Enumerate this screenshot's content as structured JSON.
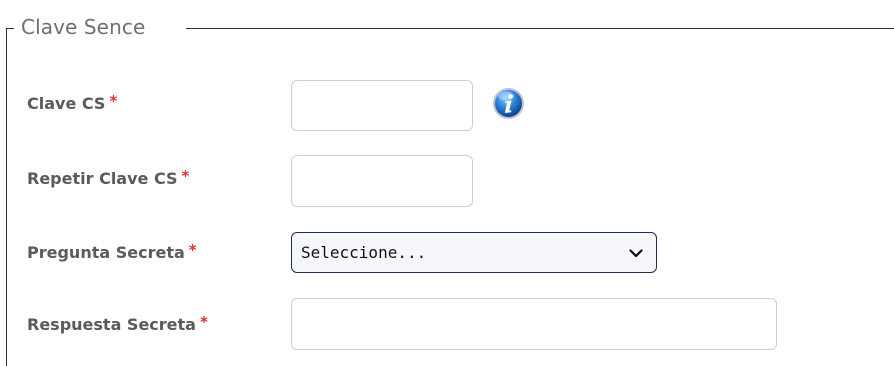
{
  "fieldset": {
    "legend": "Clave Sence"
  },
  "required_marker": "*",
  "fields": {
    "clave_cs": {
      "label": "Clave CS",
      "value": ""
    },
    "repetir_clave_cs": {
      "label": "Repetir Clave CS",
      "value": ""
    },
    "pregunta_secreta": {
      "label": "Pregunta Secreta",
      "selected": "Seleccione..."
    },
    "respuesta_secreta": {
      "label": "Respuesta Secreta",
      "value": ""
    }
  },
  "icons": {
    "info": "info-icon",
    "select_arrow": "chevron-down-icon"
  },
  "colors": {
    "required": "#e03030",
    "info_icon": "#2d7fd3",
    "select_border": "#1f2d55"
  }
}
